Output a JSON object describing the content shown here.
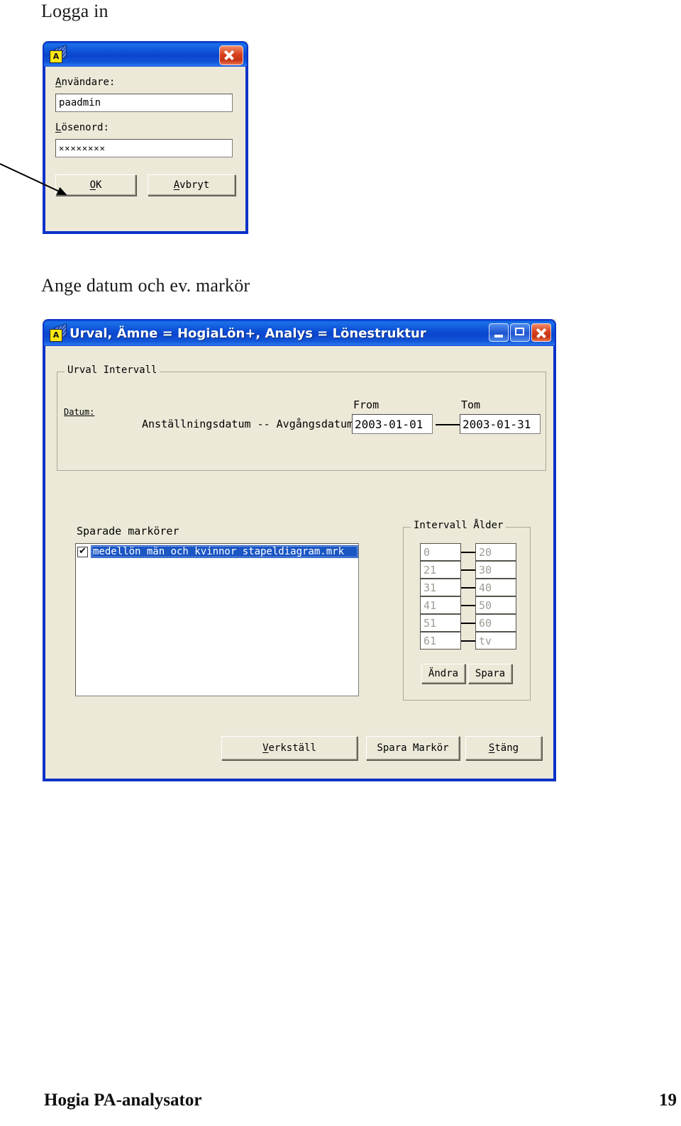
{
  "document": {
    "heading_login": "Logga in",
    "heading_date": "Ange datum och ev. markör",
    "footer_left": "Hogia PA-analysator",
    "footer_page": "19"
  },
  "login_dialog": {
    "icon": "app-cube-icon",
    "icon_letter": "A",
    "title": "",
    "close_button": "close-icon",
    "username_label": "Användare:",
    "username_value": "paadmin",
    "password_label": "Lösenord:",
    "password_value": "✕✕✕✕✕✕✕✕",
    "ok_button": "OK",
    "cancel_button": "Avbryt"
  },
  "annotation": {
    "arrow": "arrow-pointing-to-ok-button"
  },
  "main_window": {
    "icon_letter": "A",
    "title": "Urval, Ämne = HogiaLön+, Analys = Lönestruktur",
    "caption_buttons": {
      "minimize": "minimize-icon",
      "maximize": "maximize-icon",
      "close": "close-icon"
    },
    "urval_intervall": {
      "group_title": "Urval Intervall",
      "datum_label": "Datum:",
      "row_label": "Anställningsdatum -- Avgångsdatum",
      "from_caption": "From",
      "from_value": "2003-01-01",
      "tom_caption": "Tom",
      "tom_value": "2003-01-31"
    },
    "sparade_markorer": {
      "label": "Sparade markörer",
      "items": [
        {
          "checked": true,
          "selected": true,
          "name": "medellön män och kvinnor stapeldiagram.mrk"
        }
      ]
    },
    "intervall_alder": {
      "group_title": "Intervall Ålder",
      "rows": [
        {
          "from": "0",
          "to": "20"
        },
        {
          "from": "21",
          "to": "30"
        },
        {
          "from": "31",
          "to": "40"
        },
        {
          "from": "41",
          "to": "50"
        },
        {
          "from": "51",
          "to": "60"
        },
        {
          "from": "61",
          "to": "tv"
        }
      ],
      "edit_button": "Ändra",
      "save_button": "Spara"
    },
    "action_buttons": {
      "apply": "Verkställ",
      "save_marker": "Spara Markör",
      "close": "Stäng"
    }
  },
  "colors": {
    "title_bar_blue": "#0b45cf",
    "window_border_blue": "#0a32c8",
    "dialog_face": "#ece9d8",
    "selection_blue": "#1a56c4",
    "close_button_red": "#d8421c",
    "disabled_text": "#9d9d95"
  }
}
